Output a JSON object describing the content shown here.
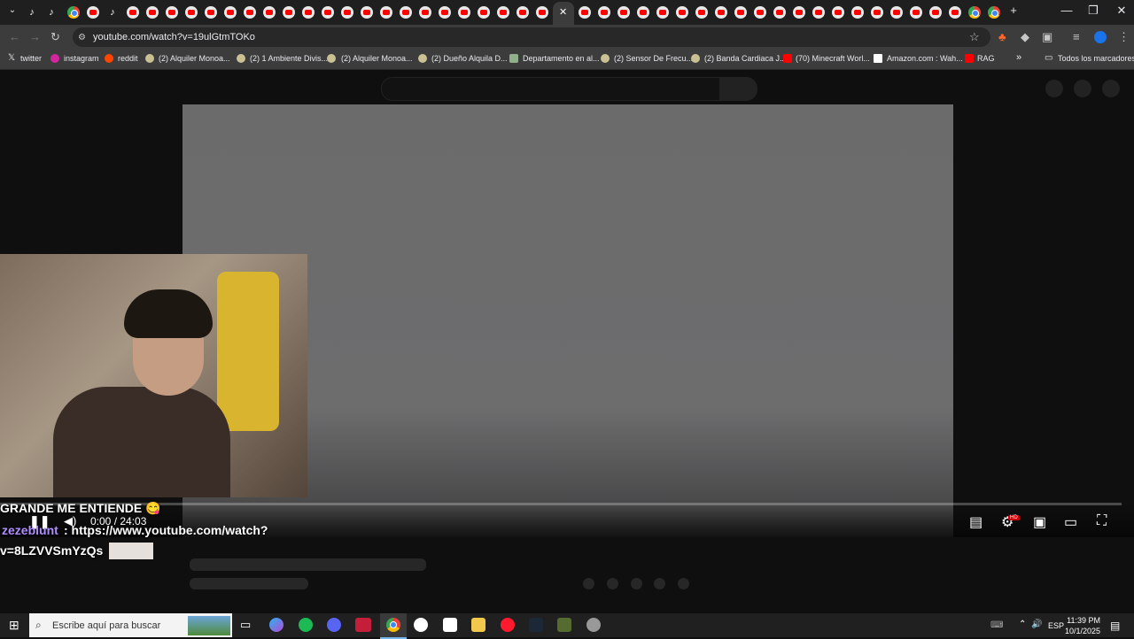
{
  "browser": {
    "url": "youtube.com/watch?v=19ulGtmTOKo",
    "window_controls": {
      "minimize": "—",
      "restore": "❐",
      "close": "✕"
    },
    "active_tab_close": "✕",
    "new_tab": "+"
  },
  "bookmarks": [
    {
      "label": "twitter",
      "icon": "x-icon"
    },
    {
      "label": "instagram",
      "icon": "instagram-icon"
    },
    {
      "label": "reddit",
      "icon": "reddit-icon"
    },
    {
      "label": "(2) Alquiler Monoa...",
      "icon": "marketplace-icon"
    },
    {
      "label": "(2) 1 Ambiente Divis...",
      "icon": "marketplace-icon"
    },
    {
      "label": "(2) Alquiler Monoa...",
      "icon": "marketplace-icon"
    },
    {
      "label": "(2) Dueño Alquila D...",
      "icon": "marketplace-icon"
    },
    {
      "label": "Departamento en al...",
      "icon": "image-icon"
    },
    {
      "label": "(2) Sensor De Frecu...",
      "icon": "marketplace-icon"
    },
    {
      "label": "(2) Banda Cardiaca J...",
      "icon": "marketplace-icon"
    },
    {
      "label": "(70) Minecraft Worl...",
      "icon": "youtube-icon"
    },
    {
      "label": "Amazon.com : Wah...",
      "icon": "amazon-icon"
    },
    {
      "label": "RAG",
      "icon": "youtube-icon"
    }
  ],
  "bookmarks_more": "»",
  "all_bookmarks": "Todos los marcadores",
  "player": {
    "time": "0:00 / 24:03",
    "hd_badge": "HD"
  },
  "overlay_chat": {
    "line1": "GRANDE ME ENTIENDE 😋",
    "user": "zezeblunt",
    "line2_text": ": https://www.youtube.com/watch?",
    "line3": "v=8LZVVSmYzQs"
  },
  "taskbar": {
    "search_placeholder": "Escribe aquí para buscar",
    "language": "ESP",
    "time": "11:39 PM",
    "date": "10/1/2025"
  },
  "colors": {
    "accent": "#ff0000",
    "profile": "#1a73e8"
  }
}
